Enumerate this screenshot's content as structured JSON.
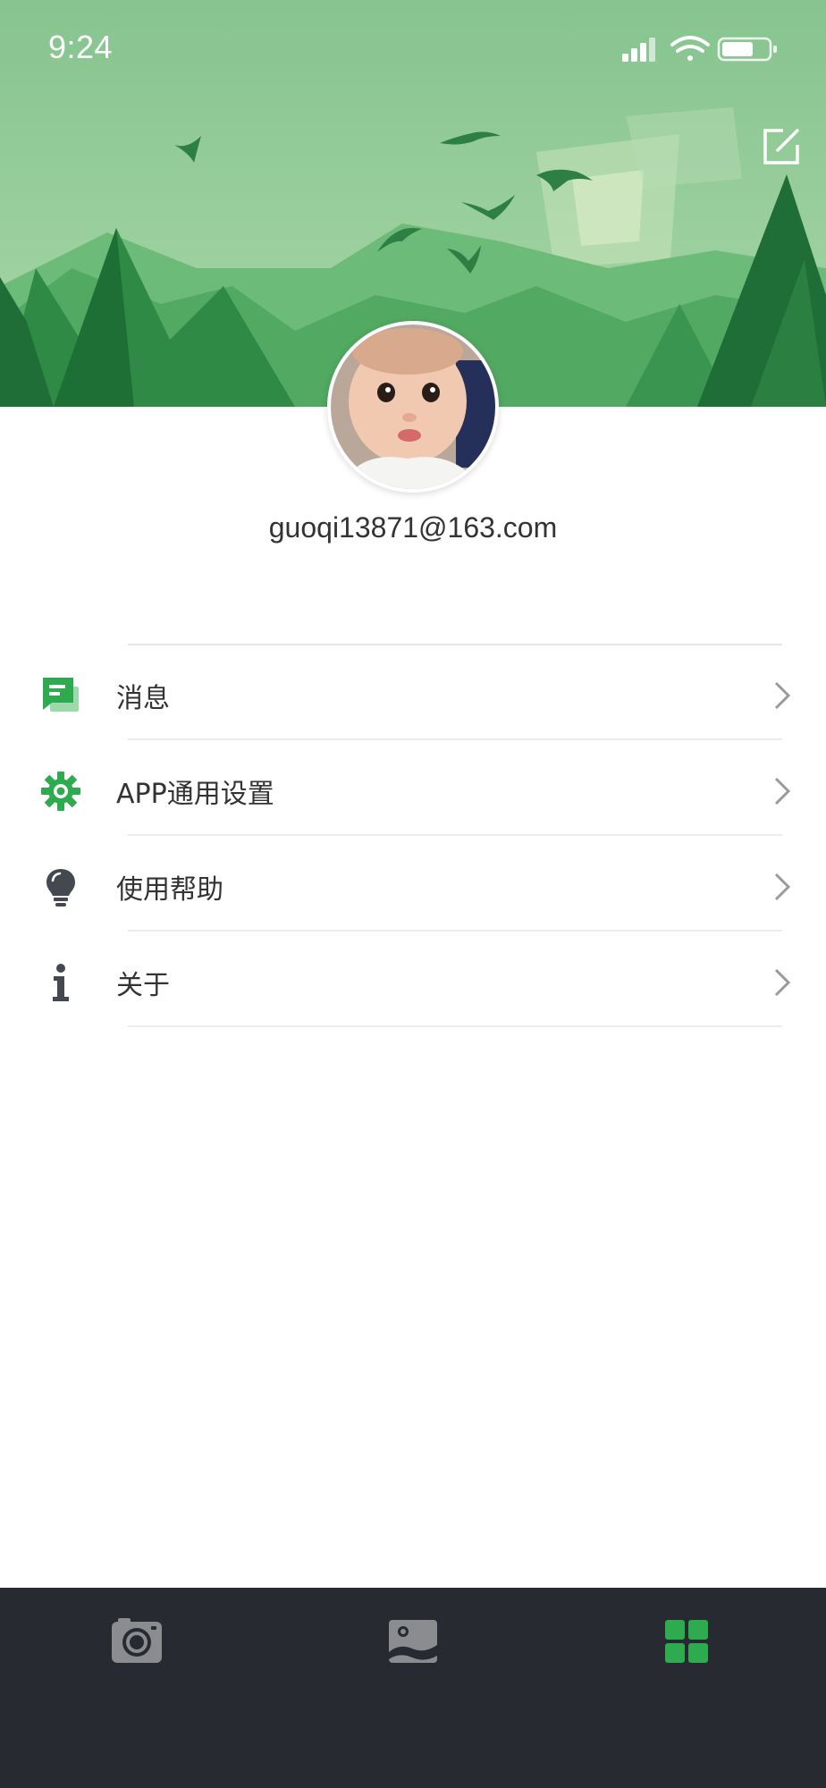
{
  "status_bar": {
    "time": "9:24",
    "icons": [
      "signal-icon",
      "wifi-icon",
      "battery-icon"
    ]
  },
  "header": {
    "edit_icon": "edit-icon"
  },
  "profile": {
    "email": "guoqi13871@163.com"
  },
  "menu": {
    "items": [
      {
        "label": "消息",
        "icon": "message-icon"
      },
      {
        "label": "APP通用设置",
        "icon": "settings-gear-icon"
      },
      {
        "label": "使用帮助",
        "icon": "lightbulb-icon"
      },
      {
        "label": "关于",
        "icon": "info-icon"
      }
    ]
  },
  "tab_bar": {
    "tabs": [
      {
        "icon": "camera-icon",
        "active": false
      },
      {
        "icon": "gallery-icon",
        "active": false
      },
      {
        "icon": "grid-icon",
        "active": true
      }
    ]
  },
  "colors": {
    "accent": "#2eaa4f",
    "tab_bar_bg": "#272a30",
    "tab_inactive": "#8a8c90",
    "icon_gray": "#444850",
    "text": "#333333"
  }
}
